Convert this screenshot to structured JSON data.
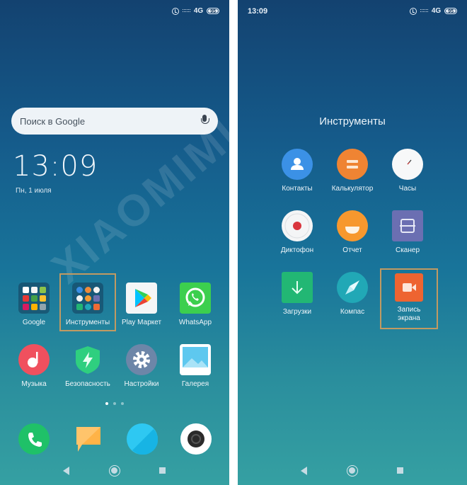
{
  "status_bar": {
    "left_time": "",
    "right_time": "13:09",
    "network": "4G",
    "battery": "95"
  },
  "home": {
    "search_placeholder": "Поиск в Google",
    "clock": "13:09",
    "date": "Пн, 1 июля",
    "apps_row1": [
      {
        "label": "Google",
        "icon": "google-folder-icon"
      },
      {
        "label": "Инструменты",
        "icon": "tools-folder-icon"
      },
      {
        "label": "Play Маркет",
        "icon": "play-store-icon"
      },
      {
        "label": "WhatsApp",
        "icon": "whatsapp-icon"
      }
    ],
    "apps_row2": [
      {
        "label": "Музыка",
        "icon": "music-icon"
      },
      {
        "label": "Безопасность",
        "icon": "security-icon"
      },
      {
        "label": "Настройки",
        "icon": "settings-icon"
      },
      {
        "label": "Галерея",
        "icon": "gallery-icon"
      }
    ],
    "page_count": 3,
    "active_page": 1,
    "dock": [
      {
        "icon": "phone-icon"
      },
      {
        "icon": "messages-icon"
      },
      {
        "icon": "browser-icon"
      },
      {
        "icon": "camera-icon"
      }
    ]
  },
  "folder": {
    "title": "Инструменты",
    "apps": [
      {
        "label": "Контакты",
        "icon": "contacts-icon"
      },
      {
        "label": "Калькулятор",
        "icon": "calculator-icon"
      },
      {
        "label": "Часы",
        "icon": "clock-icon"
      },
      {
        "label": "Диктофон",
        "icon": "recorder-icon"
      },
      {
        "label": "Отчет",
        "icon": "feedback-icon"
      },
      {
        "label": "Сканер",
        "icon": "scanner-icon"
      },
      {
        "label": "Загрузки",
        "icon": "downloads-icon"
      },
      {
        "label": "Компас",
        "icon": "compass-icon"
      },
      {
        "label": "Запись\nэкрана",
        "label_line1": "Запись",
        "label_line2": "экрана",
        "icon": "screen-recorder-icon"
      }
    ]
  },
  "watermark": "XIAOMIMI",
  "colors": {
    "highlight": "#c19a62",
    "bg_top": "#134270",
    "bg_bottom": "#35a0a2"
  }
}
